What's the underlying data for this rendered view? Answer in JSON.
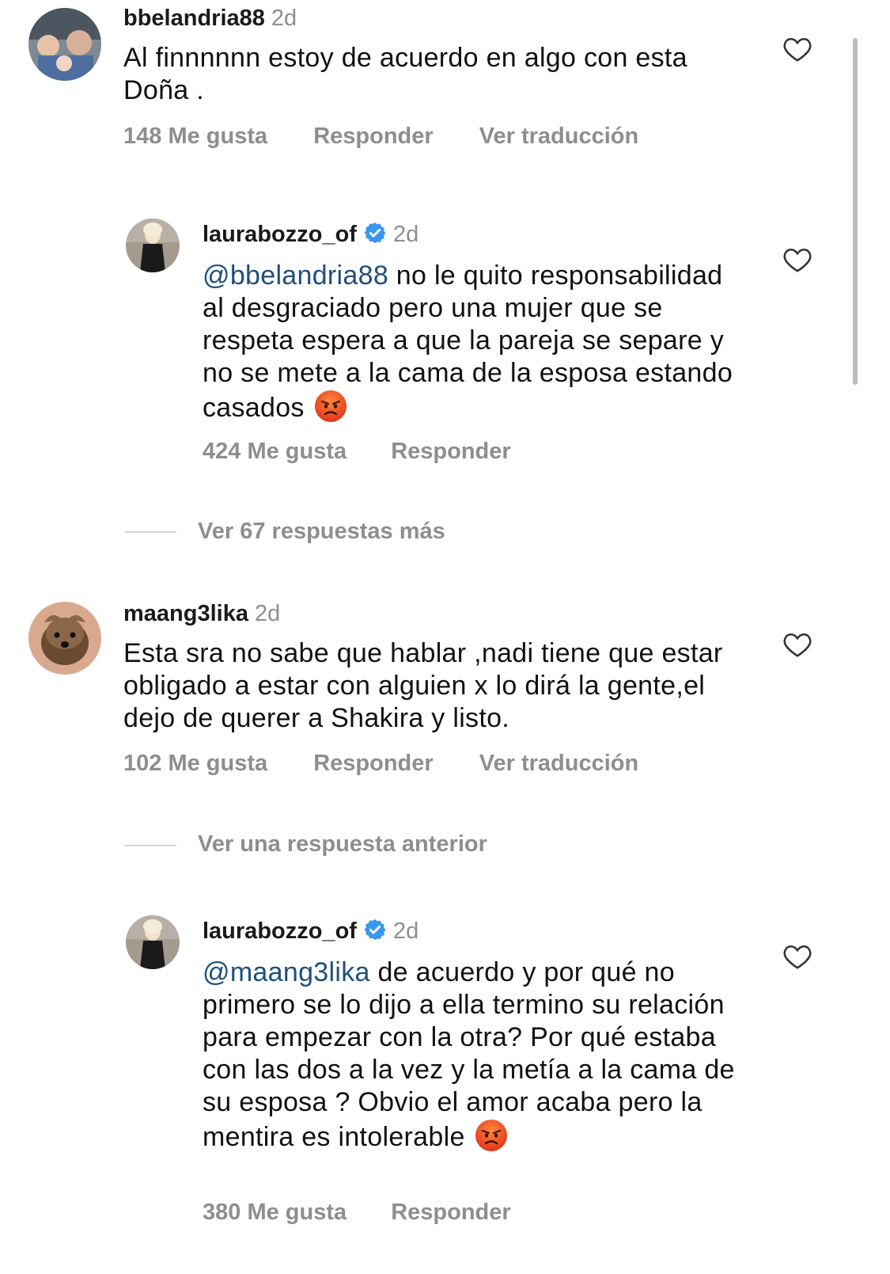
{
  "comments": [
    {
      "username": "bbelandria88",
      "time": "2d",
      "text": "Al finnnnnn estoy de acuerdo en algo con esta Doña .",
      "likes": "148 Me gusta",
      "reply": "Responder",
      "translate": "Ver traducción"
    },
    {
      "username": "laurabozzo_of",
      "time": "2d",
      "mention": "@bbelandria88",
      "text": " no le quito responsabilidad al desgraciado pero una mujer que se respeta espera a que la pareja se separe y no se mete a la cama de la esposa estando casados",
      "likes": "424 Me gusta",
      "reply": "Responder"
    },
    {
      "more": "Ver 67 respuestas más"
    },
    {
      "username": "maang3lika",
      "time": "2d",
      "text": "Esta sra no sabe que hablar ,nadi tiene que estar obligado a estar con alguien x lo dirá la gente,el dejo de querer a Shakira y listo.",
      "likes": "102 Me gusta",
      "reply": "Responder",
      "translate": "Ver traducción"
    },
    {
      "more": "Ver una respuesta anterior"
    },
    {
      "username": "laurabozzo_of",
      "time": "2d",
      "mention": "@maang3lika",
      "text": " de acuerdo y por qué no primero se lo dijo a ella termino su relación para empezar con la otra? Por qué estaba con las dos a la vez y la metía a la cama de su esposa ? Obvio el amor acaba pero la mentira es intolerable",
      "likes": "380 Me gusta",
      "reply": "Responder"
    }
  ],
  "icons": {
    "like": "heart-outline-icon",
    "verified": "verified-badge-icon",
    "emoji": "angry-face-emoji"
  },
  "colors": {
    "mention": "#1f4f7c",
    "muted": "#8e8e8e",
    "verified": "#3897f0"
  }
}
